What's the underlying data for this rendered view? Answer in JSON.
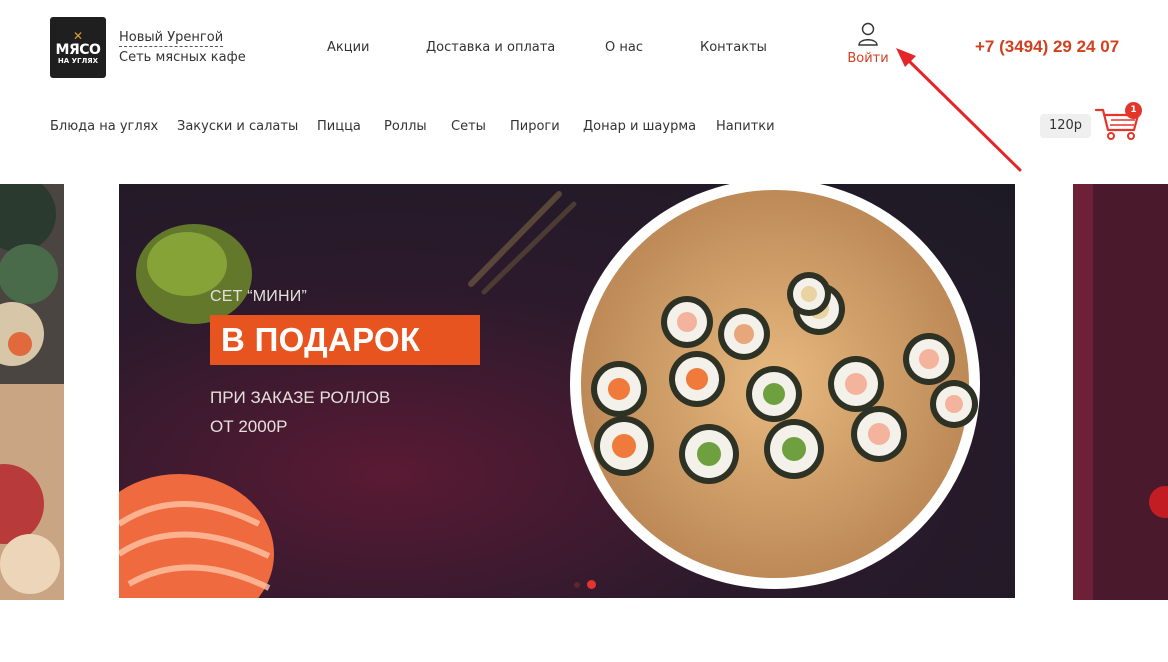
{
  "header": {
    "logo": {
      "line1": "МЯСО",
      "line2": "НА УГЛЯХ"
    },
    "city": "Новый Уренгой",
    "subtitle": "Сеть мясных кафе",
    "top_nav": [
      "Акции",
      "Доставка и оплата",
      "О нас",
      "Контакты"
    ],
    "login": {
      "label": "Войти",
      "icon": "user-icon"
    },
    "phone": "+7 (3494) 29 24 07",
    "accent_color": "#d2401f"
  },
  "category_nav": [
    "Блюда на углях",
    "Закуски и салаты",
    "Пицца",
    "Роллы",
    "Сеты",
    "Пироги",
    "Донар и шаурма",
    "Напитки"
  ],
  "cart": {
    "sum": "120р",
    "count": "1",
    "icon": "cart-icon",
    "badge_color": "#e4352a"
  },
  "banner": {
    "eyebrow": "СЕТ “МИНИ”",
    "headline": "В ПОДАРОК",
    "line1": "ПРИ ЗАКАЗЕ РОЛЛОВ",
    "line2": "ОТ 2000Р",
    "headline_bg": "#e8541f",
    "slides_total": 2,
    "active_slide": 2
  },
  "annotation": {
    "type": "red-arrow",
    "points_to": "login",
    "color": "#e4252a"
  }
}
